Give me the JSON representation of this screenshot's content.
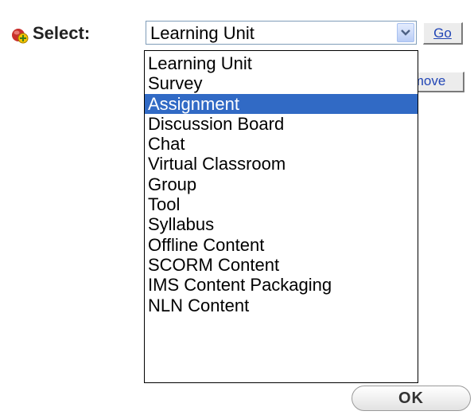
{
  "toolbar": {
    "select_label": "Select:",
    "add_icon": "add-content-icon",
    "go_label": "Go",
    "remove_label": "Remove"
  },
  "combo": {
    "value": "Learning Unit",
    "arrow_icon": "chevron-down-icon"
  },
  "dropdown": {
    "selected_index": 2,
    "highlight_color": "#316ac5",
    "options": [
      "Learning Unit",
      "Survey",
      "Assignment",
      "Discussion Board",
      "Chat",
      "Virtual Classroom",
      "Group",
      "Tool",
      "Syllabus",
      "Offline Content",
      "SCORM Content",
      "IMS Content Packaging",
      "NLN Content"
    ]
  },
  "footer": {
    "ok_label": "OK"
  }
}
